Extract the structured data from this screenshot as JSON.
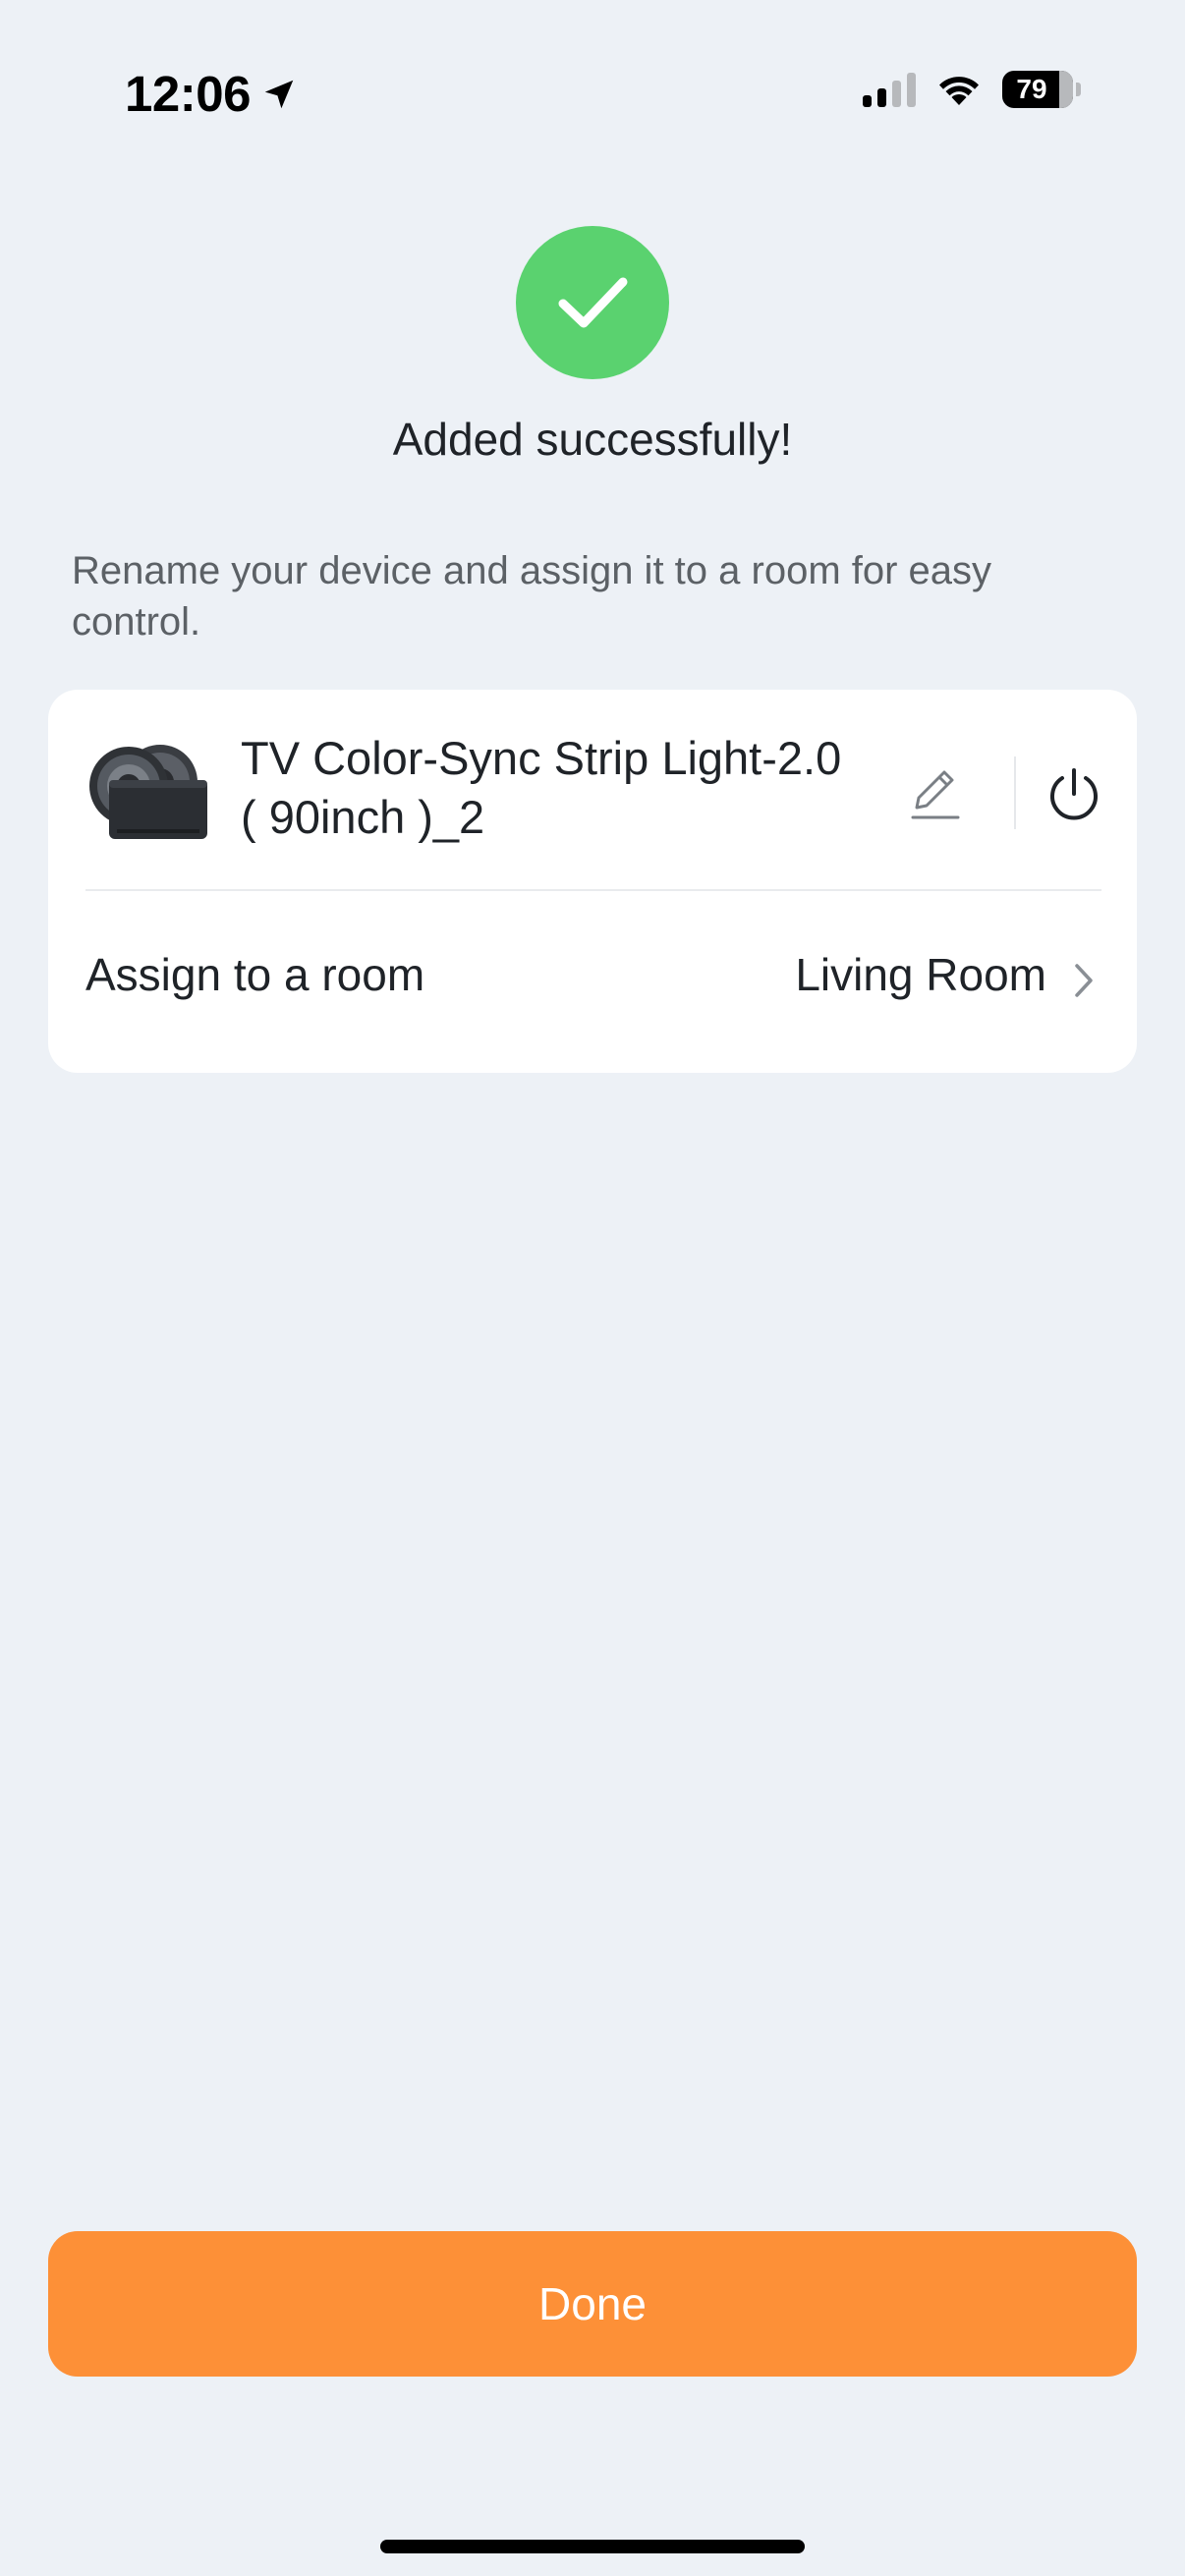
{
  "status_bar": {
    "time": "12:06",
    "location_icon": "location-arrow-icon",
    "signal_icon": "cellular-signal-icon",
    "wifi_icon": "wifi-icon",
    "battery_level": "79"
  },
  "success": {
    "icon": "checkmark-icon",
    "title": "Added successfully!"
  },
  "instruction": "Rename your device and assign it to a room for easy control.",
  "device": {
    "name_line1": "TV Color-Sync Strip Light-2.0",
    "name_line2": "( 90inch )_2",
    "edit_icon": "pencil-icon",
    "power_icon": "power-icon"
  },
  "room": {
    "label": "Assign to a room",
    "value": "Living Room"
  },
  "done_label": "Done",
  "colors": {
    "background": "#edf1f6",
    "success_green": "#5ad26f",
    "accent_orange": "#fd9037",
    "card": "#ffffff"
  }
}
